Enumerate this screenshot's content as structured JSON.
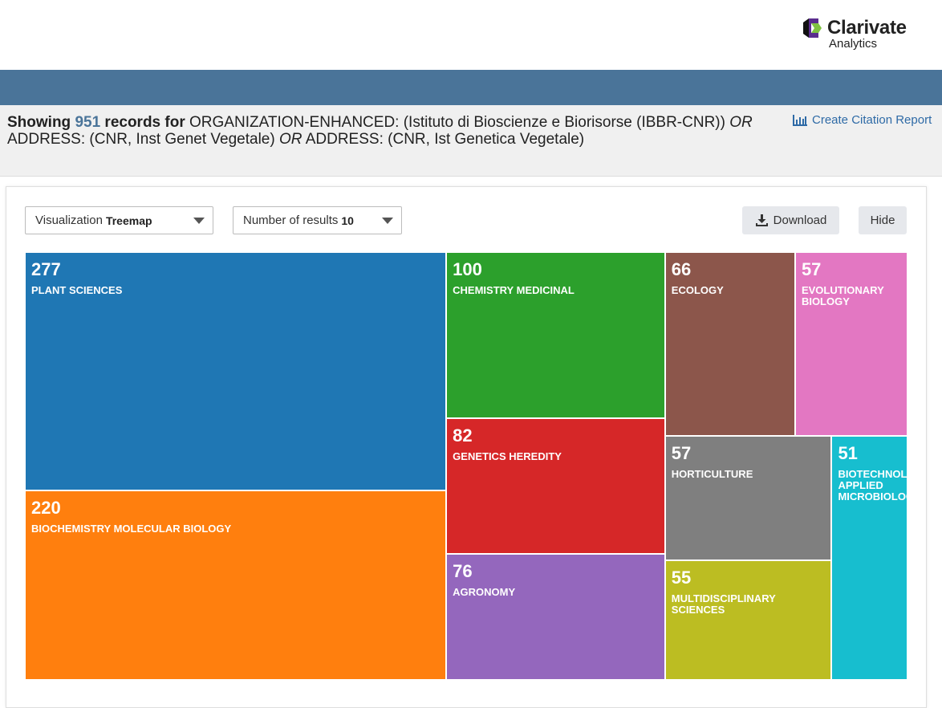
{
  "brand": {
    "name": "Clarivate",
    "sub": "Analytics"
  },
  "summary": {
    "showing": "Showing",
    "count": "951",
    "records_for": "records for",
    "field1": "ORGANIZATION-ENHANCED:",
    "value1": "(Istituto di Bioscienze e Biorisorse (IBBR-CNR))",
    "or1": "OR",
    "field2": "ADDRESS:",
    "value2": "(CNR, Inst Genet Vegetale)",
    "or2": "OR",
    "field3": "ADDRESS:",
    "value3": "(CNR, Ist Genetica Vegetale)"
  },
  "citation_report": "Create Citation Report",
  "controls": {
    "visualization_label": "Visualization",
    "visualization_value": "Treemap",
    "results_label": "Number of results",
    "results_value": "10",
    "download": "Download",
    "hide": "Hide"
  },
  "chart_data": {
    "type": "treemap",
    "items": [
      {
        "name": "PLANT SCIENCES",
        "value": 277,
        "color": "#1f77b4"
      },
      {
        "name": "BIOCHEMISTRY MOLECULAR BIOLOGY",
        "value": 220,
        "color": "#ff7f0e"
      },
      {
        "name": "CHEMISTRY MEDICINAL",
        "value": 100,
        "color": "#2ca02c"
      },
      {
        "name": "GENETICS HEREDITY",
        "value": 82,
        "color": "#d62728"
      },
      {
        "name": "AGRONOMY",
        "value": 76,
        "color": "#9467bd"
      },
      {
        "name": "ECOLOGY",
        "value": 66,
        "color": "#8c564b"
      },
      {
        "name": "EVOLUTIONARY BIOLOGY",
        "value": 57,
        "color": "#e377c2"
      },
      {
        "name": "HORTICULTURE",
        "value": 57,
        "color": "#7f7f7f"
      },
      {
        "name": "MULTIDISCIPLINARY SCIENCES",
        "value": 55,
        "color": "#bcbd22"
      },
      {
        "name": "BIOTECHNOLOGY APPLIED MICROBIOLOGY",
        "value": 51,
        "color": "#17becf"
      }
    ]
  }
}
